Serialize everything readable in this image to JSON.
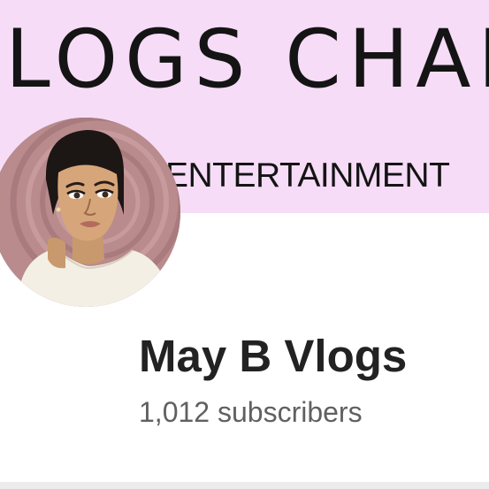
{
  "banner": {
    "title": "LOGS CHAN",
    "subtitle": "ENTERTAINMENT",
    "background_color": "#f6dcf7"
  },
  "avatar": {
    "icon": "profile-illustration",
    "background_color": "#b98b8d"
  },
  "channel": {
    "name": "May B Vlogs",
    "subscribers": "1,012 subscribers"
  }
}
